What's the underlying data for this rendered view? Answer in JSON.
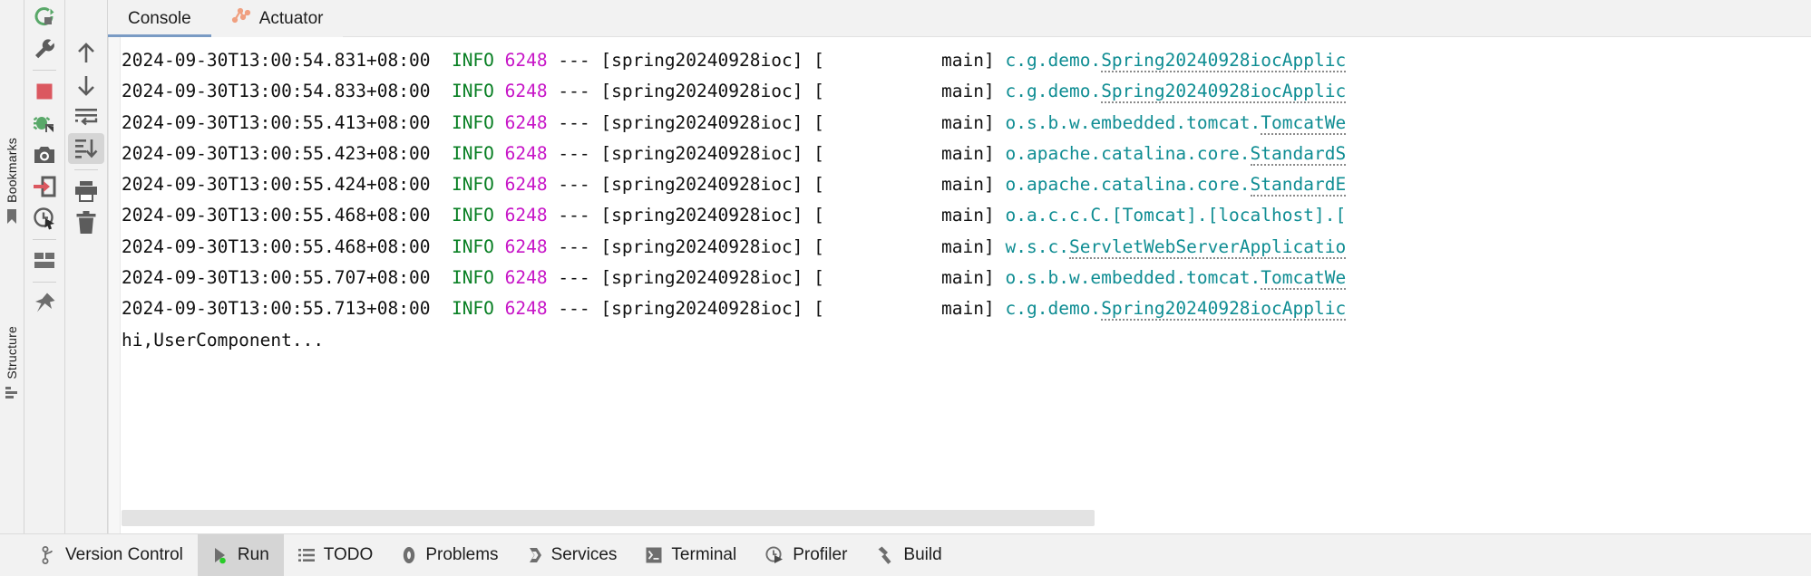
{
  "window": {
    "background": "#f2f2f2",
    "console_background": "#ffffff"
  },
  "left_stripe": {
    "items": [
      {
        "id": "bookmarks",
        "label": "Bookmarks",
        "icon": "bookmark-icon"
      },
      {
        "id": "structure",
        "label": "Structure",
        "icon": "structure-icon"
      }
    ]
  },
  "run_toolbar": {
    "buttons": [
      {
        "id": "rerun",
        "label": "Rerun",
        "icon": "rerun-icon",
        "color": "#59a869"
      },
      {
        "id": "settings",
        "label": "Modify Run Configuration",
        "icon": "wrench-icon",
        "color": "#6e6e6e"
      },
      {
        "id": "stop",
        "label": "Stop",
        "icon": "stop-icon",
        "color": "#db5860"
      },
      {
        "id": "debug",
        "label": "Attach Debugger",
        "icon": "debugger-icon",
        "color": "#59a869"
      },
      {
        "id": "screenshot",
        "label": "Capture Screenshot",
        "icon": "camera-icon",
        "color": "#6e6e6e"
      },
      {
        "id": "import",
        "label": "Import Snapshot",
        "icon": "import-icon",
        "color": "#db5860"
      },
      {
        "id": "history",
        "label": "Run History",
        "icon": "clock-pointer-icon",
        "color": "#6e6e6e"
      },
      {
        "id": "layout",
        "label": "Layout Settings",
        "icon": "layout-icon",
        "color": "#6e6e6e"
      },
      {
        "id": "pin",
        "label": "Pin Tab",
        "icon": "pin-icon",
        "color": "#6e6e6e"
      }
    ]
  },
  "console_toolbar": {
    "buttons": [
      {
        "id": "up",
        "label": "Up the Stack Trace",
        "icon": "arrow-up-icon",
        "selected": false
      },
      {
        "id": "down",
        "label": "Down the Stack Trace",
        "icon": "arrow-down-icon",
        "selected": false
      },
      {
        "id": "softwrap",
        "label": "Soft-Wrap",
        "icon": "soft-wrap-icon",
        "selected": false
      },
      {
        "id": "scroll-end",
        "label": "Scroll to the End",
        "icon": "scroll-to-end-icon",
        "selected": true
      },
      {
        "id": "print",
        "label": "Print",
        "icon": "printer-icon",
        "selected": false
      },
      {
        "id": "clear",
        "label": "Clear All",
        "icon": "trash-icon",
        "selected": false
      }
    ]
  },
  "tabs": {
    "items": [
      {
        "id": "console",
        "label": "Console",
        "icon": "console-icon",
        "active": true
      },
      {
        "id": "actuator",
        "label": "Actuator",
        "icon": "actuator-icon",
        "active": false
      }
    ],
    "active_underline_color": "#7a9bc4"
  },
  "console": {
    "colors": {
      "timestamp": "#111111",
      "level_info": "#087f23",
      "pid": "#c716c7",
      "class": "#0f8d93",
      "plain": "#111111"
    },
    "lines": [
      {
        "ts": "2024-09-30T13:00:54.831+08:00",
        "level": "INFO",
        "pid": "6248",
        "sep": "---",
        "app": "[spring20240928ioc]",
        "thread": "[           main]",
        "pkg": "c.g.demo.",
        "cls": "Spring20240928iocApplic"
      },
      {
        "ts": "2024-09-30T13:00:54.833+08:00",
        "level": "INFO",
        "pid": "6248",
        "sep": "---",
        "app": "[spring20240928ioc]",
        "thread": "[           main]",
        "pkg": "c.g.demo.",
        "cls": "Spring20240928iocApplic"
      },
      {
        "ts": "2024-09-30T13:00:55.413+08:00",
        "level": "INFO",
        "pid": "6248",
        "sep": "---",
        "app": "[spring20240928ioc]",
        "thread": "[           main]",
        "pkg": "o.s.b.w.embedded.tomcat.",
        "cls": "TomcatWe"
      },
      {
        "ts": "2024-09-30T13:00:55.423+08:00",
        "level": "INFO",
        "pid": "6248",
        "sep": "---",
        "app": "[spring20240928ioc]",
        "thread": "[           main]",
        "pkg": "o.apache.catalina.core.",
        "cls": "StandardS"
      },
      {
        "ts": "2024-09-30T13:00:55.424+08:00",
        "level": "INFO",
        "pid": "6248",
        "sep": "---",
        "app": "[spring20240928ioc]",
        "thread": "[           main]",
        "pkg": "o.apache.catalina.core.",
        "cls": "StandardE"
      },
      {
        "ts": "2024-09-30T13:00:55.468+08:00",
        "level": "INFO",
        "pid": "6248",
        "sep": "---",
        "app": "[spring20240928ioc]",
        "thread": "[           main]",
        "pkg": "o.a.c.c.C.[Tomcat].[localhost].[",
        "cls": ""
      },
      {
        "ts": "2024-09-30T13:00:55.468+08:00",
        "level": "INFO",
        "pid": "6248",
        "sep": "---",
        "app": "[spring20240928ioc]",
        "thread": "[           main]",
        "pkg": "w.s.c.",
        "cls": "ServletWebServerApplicatio"
      },
      {
        "ts": "2024-09-30T13:00:55.707+08:00",
        "level": "INFO",
        "pid": "6248",
        "sep": "---",
        "app": "[spring20240928ioc]",
        "thread": "[           main]",
        "pkg": "o.s.b.w.embedded.tomcat.",
        "cls": "TomcatWe"
      },
      {
        "ts": "2024-09-30T13:00:55.713+08:00",
        "level": "INFO",
        "pid": "6248",
        "sep": "---",
        "app": "[spring20240928ioc]",
        "thread": "[           main]",
        "pkg": "c.g.demo.",
        "cls": "Spring20240928iocApplic"
      }
    ],
    "plain_output": "hi,UserComponent..."
  },
  "status_bar": {
    "items": [
      {
        "id": "version-control",
        "label": "Version Control",
        "icon": "branch-icon",
        "active": false
      },
      {
        "id": "run",
        "label": "Run",
        "icon": "run-icon",
        "active": true
      },
      {
        "id": "todo",
        "label": "TODO",
        "icon": "todo-icon",
        "active": false
      },
      {
        "id": "problems",
        "label": "Problems",
        "icon": "problems-icon",
        "active": false
      },
      {
        "id": "services",
        "label": "Services",
        "icon": "services-icon",
        "active": false
      },
      {
        "id": "terminal",
        "label": "Terminal",
        "icon": "terminal-icon",
        "active": false
      },
      {
        "id": "profiler",
        "label": "Profiler",
        "icon": "profiler-icon",
        "active": false
      },
      {
        "id": "build",
        "label": "Build",
        "icon": "build-icon",
        "active": false
      }
    ]
  }
}
